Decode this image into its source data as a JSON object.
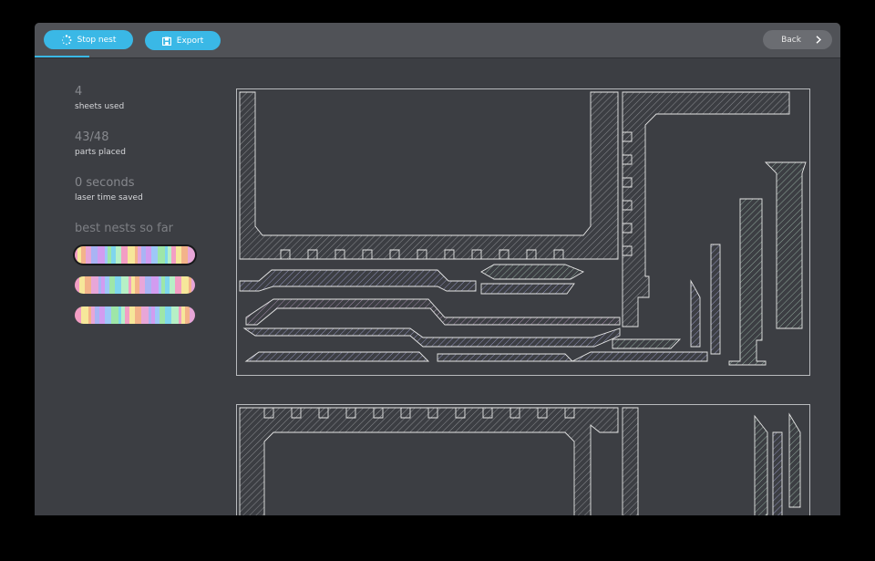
{
  "toolbar": {
    "stop_label": "Stop nest",
    "export_label": "Export",
    "back_label": "Back"
  },
  "stats": {
    "sheets_value": "4",
    "sheets_label": "sheets used",
    "parts_value": "43/48",
    "parts_label": "parts placed",
    "time_value": "0 seconds",
    "time_label": "laser time saved"
  },
  "best_nests": {
    "title": "best nests so far",
    "palette": [
      "#f39ec4",
      "#9ee6a8",
      "#a9b4f4",
      "#f6e79a",
      "#7fd6ee",
      "#d29cf0",
      "#f3b38a",
      "#b6f0c6",
      "#9ec8f8",
      "#e8a6d8"
    ],
    "selected_index": 0
  },
  "colors": {
    "accent": "#3ab8e6",
    "background": "#3c3e43",
    "toolbar": "#505257",
    "part_outline": "#e6e6e6"
  }
}
